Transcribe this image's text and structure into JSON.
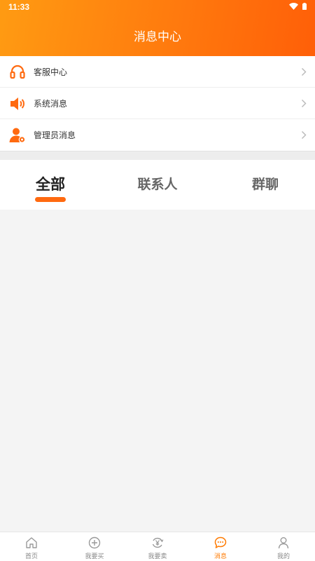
{
  "status_bar": {
    "time": "11:33"
  },
  "header": {
    "title": "消息中心"
  },
  "colors": {
    "brand": "#ff7a0e",
    "active": "#ff6a10",
    "text": "#333333",
    "inactive": "#888888"
  },
  "list": {
    "items": [
      {
        "label": "客服中心",
        "icon": "headset-icon"
      },
      {
        "label": "系统消息",
        "icon": "speaker-icon"
      },
      {
        "label": "管理员消息",
        "icon": "admin-user-icon"
      }
    ]
  },
  "tabs": {
    "items": [
      {
        "label": "全部",
        "active": true
      },
      {
        "label": "联系人",
        "active": false
      },
      {
        "label": "群聊",
        "active": false
      }
    ]
  },
  "bottom_nav": {
    "items": [
      {
        "label": "首页",
        "icon": "home-icon",
        "active": false
      },
      {
        "label": "我要买",
        "icon": "plus-circle-icon",
        "active": false
      },
      {
        "label": "我要卖",
        "icon": "yen-exchange-icon",
        "active": false
      },
      {
        "label": "消息",
        "icon": "chat-bubble-icon",
        "active": true
      },
      {
        "label": "我的",
        "icon": "person-icon",
        "active": false
      }
    ]
  }
}
